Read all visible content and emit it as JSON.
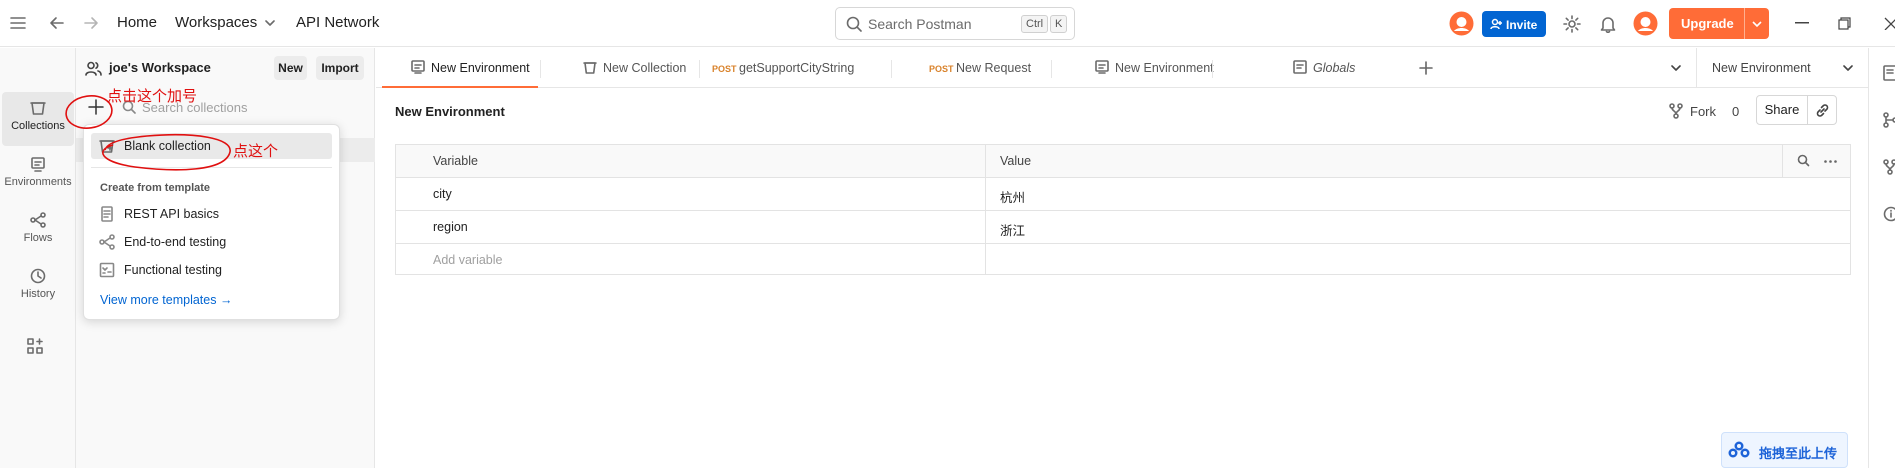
{
  "topbar": {
    "home": "Home",
    "workspaces": "Workspaces",
    "api_network": "API Network",
    "search_placeholder": "Search Postman",
    "kbd_ctrl": "Ctrl",
    "kbd_k": "K",
    "invite": "Invite",
    "upgrade": "Upgrade"
  },
  "rail": {
    "items": [
      {
        "label": "Collections"
      },
      {
        "label": "Environments"
      },
      {
        "label": "Flows"
      },
      {
        "label": "History"
      }
    ]
  },
  "sidebar": {
    "workspace_name": "joe's Workspace",
    "new_label": "New",
    "import_label": "Import",
    "search_placeholder": "Search collections"
  },
  "menu": {
    "blank_collection": "Blank collection",
    "template_heading": "Create from template",
    "templates": [
      {
        "label": "REST API basics"
      },
      {
        "label": "End-to-end testing"
      },
      {
        "label": "Functional testing"
      }
    ],
    "view_more": "View more templates →"
  },
  "annotations": {
    "plus_hint": "点击这个加号",
    "click_hint": "点这个"
  },
  "tabs": [
    {
      "label": "New Environment",
      "method": ""
    },
    {
      "label": "New Collection",
      "method": ""
    },
    {
      "label": "getSupportCityString",
      "method": "POST"
    },
    {
      "label": "New Request",
      "method": "POST"
    },
    {
      "label": "New Environment",
      "method": ""
    },
    {
      "label": "Globals",
      "method": ""
    }
  ],
  "env_selector": "New Environment",
  "main": {
    "title": "New Environment",
    "fork_label": "Fork",
    "fork_count": "0",
    "share_label": "Share",
    "columns": {
      "variable": "Variable",
      "value": "Value"
    },
    "rows": [
      {
        "variable": "city",
        "value": "杭州"
      },
      {
        "variable": "region",
        "value": "浙江"
      }
    ],
    "add_variable": "Add variable"
  },
  "upload_widget": "拖拽至此上传",
  "colors": {
    "accent": "#ff6c37",
    "invite": "#0265d2",
    "annotation": "#e01010"
  }
}
